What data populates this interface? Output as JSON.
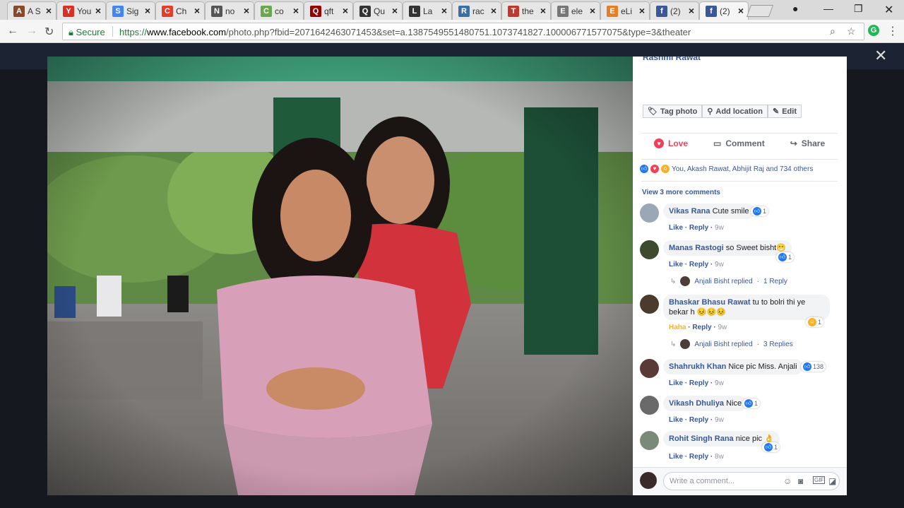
{
  "browser": {
    "tabs": [
      {
        "title": "A S",
        "icon": "shield-icon",
        "color": "#8a4a2a"
      },
      {
        "title": "You",
        "icon": "gmail-icon",
        "color": "#d93025"
      },
      {
        "title": "Sig",
        "icon": "google-icon",
        "color": "#4285f4"
      },
      {
        "title": "Ch",
        "icon": "e-icon",
        "color": "#e23d2d"
      },
      {
        "title": "no",
        "icon": "openai-icon",
        "color": "#555555"
      },
      {
        "title": "co",
        "icon": "chart-icon",
        "color": "#6aa84f"
      },
      {
        "title": "qft",
        "icon": "iu-icon",
        "color": "#990000"
      },
      {
        "title": "Qu",
        "icon": "wikipedia-icon",
        "color": "#333333"
      },
      {
        "title": "La",
        "icon": "wikipedia-icon",
        "color": "#333333"
      },
      {
        "title": "rac",
        "icon": "ibm-icon",
        "color": "#3a6ea5"
      },
      {
        "title": "the",
        "icon": "book-icon",
        "color": "#c0392b"
      },
      {
        "title": "ele",
        "icon": "doc-icon",
        "color": "#777777"
      },
      {
        "title": "eLi",
        "icon": "eli-icon",
        "color": "#e67e22"
      },
      {
        "title": "(2)",
        "icon": "facebook-icon",
        "color": "#3b5998"
      },
      {
        "title": "(2)",
        "icon": "facebook-icon",
        "color": "#3b5998"
      }
    ],
    "secure_label": "Secure",
    "url_scheme": "https://",
    "url_host": "www.facebook.com",
    "url_path": "/photo.php?fbid=2071642463071453&set=a.1387549551480751.1073741827.100006771577075&type=3&theater"
  },
  "post": {
    "author": "Rashmi Rawat",
    "tag_photo": "Tag photo",
    "add_location": "Add location",
    "edit": "Edit",
    "love": "Love",
    "comment": "Comment",
    "share": "Share",
    "likes_summary": "You, Akash Rawat, Abhijit Raj and 734 others",
    "view_more": "View 3 more comments",
    "write_placeholder": "Write a comment..."
  },
  "comments": [
    {
      "name": "Vikas Rana",
      "text": "Cute smile",
      "like": "Like",
      "reply": "Reply",
      "time": "9w",
      "reactions": "1"
    },
    {
      "name": "Manas Rastogi",
      "text": "so Sweet bisht😁",
      "like": "Like",
      "reply": "Reply",
      "time": "9w",
      "reactions": "1",
      "reply_author": "Anjali Bisht replied",
      "reply_count": "1 Reply"
    },
    {
      "name": "Bhaskar Bhasu Rawat",
      "text": "tu to bolri thi ye bekar h 😣😣😣",
      "like": "Haha",
      "reply": "Reply",
      "time": "9w",
      "reactions": "1",
      "reply_author": "Anjali Bisht replied",
      "reply_count": "3 Replies"
    },
    {
      "name": "Shahrukh Khan",
      "text": "Nice pic Miss. Anjali",
      "like": "Like",
      "reply": "Reply",
      "time": "9w",
      "reactions": "138"
    },
    {
      "name": "Vikash Dhuliya",
      "text": "Nice",
      "like": "Like",
      "reply": "Reply",
      "time": "9w",
      "reactions": "1"
    },
    {
      "name": "Rohit Singh Rana",
      "text": "nice pic 👌",
      "like": "Like",
      "reply": "Reply",
      "time": "8w",
      "reactions": "1"
    }
  ]
}
